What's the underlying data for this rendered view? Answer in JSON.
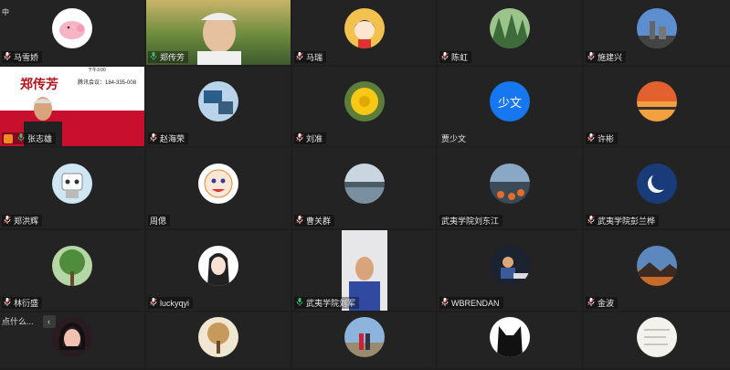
{
  "top_left_text": "中",
  "float_bar": {
    "text": "点什么...",
    "collapse_icon": "chevron-left-icon"
  },
  "tiles": [
    {
      "name": "马雪娇",
      "avatar": "pink-pig"
    },
    {
      "name": "郑传芳",
      "avatar": "video-man"
    },
    {
      "name": "马瑞",
      "avatar": "cartoon-girl"
    },
    {
      "name": "陈虹",
      "avatar": "forest"
    },
    {
      "name": "施建兴",
      "avatar": "city-sky"
    },
    {
      "name": "张志雄",
      "avatar": "share-screen",
      "slide": {
        "title": "郑传芳",
        "time": "下午3:00",
        "meeting": "腾讯会议：184-335-008"
      }
    },
    {
      "name": "赵海荣",
      "avatar": "desk"
    },
    {
      "name": "刘准",
      "avatar": "yellow-flower"
    },
    {
      "name": "贾少文",
      "avatar": "text",
      "avatar_text": "少文"
    },
    {
      "name": "许彬",
      "avatar": "sunset"
    },
    {
      "name": "郑洪辉",
      "avatar": "robot"
    },
    {
      "name": "周偲",
      "avatar": "cat-cartoon",
      "muted_icon": false
    },
    {
      "name": "曹关群",
      "avatar": "winter-lake"
    },
    {
      "name": "武夷学院刘东江",
      "avatar": "lake-flowers",
      "muted_icon": false
    },
    {
      "name": "武夷学院彭兰桦",
      "avatar": "moon"
    },
    {
      "name": "林衍盛",
      "avatar": "green-tree"
    },
    {
      "name": "luckyqyi",
      "avatar": "anime-girl"
    },
    {
      "name": "武夷学院刘军",
      "avatar": "video-person",
      "active": true
    },
    {
      "name": "WBRENDAN",
      "avatar": "piano"
    },
    {
      "name": "金波",
      "avatar": "mountain-sunset"
    },
    {
      "name": "",
      "avatar": "woman-selfie"
    },
    {
      "name": "",
      "avatar": "autumn-tree"
    },
    {
      "name": "",
      "avatar": "couple"
    },
    {
      "name": "",
      "avatar": "black-cat"
    },
    {
      "name": "",
      "avatar": "paper-note"
    }
  ]
}
